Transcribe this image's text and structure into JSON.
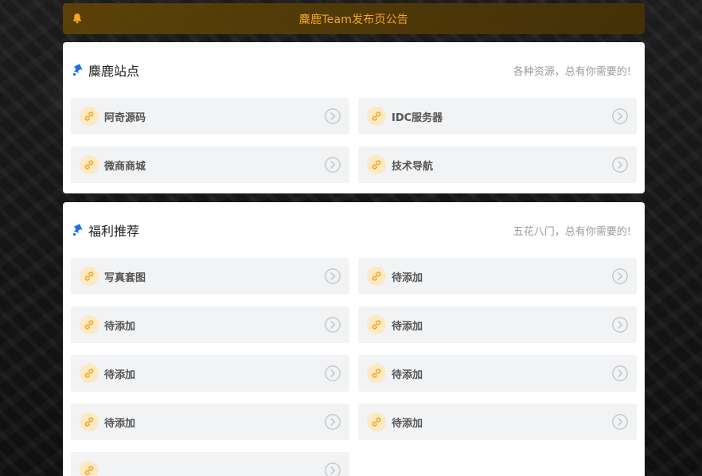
{
  "notice": {
    "text": "麋鹿Team发布页公告"
  },
  "sections": [
    {
      "title": "麋鹿站点",
      "subtitle": "各种资源，总有你需要的!",
      "items": [
        {
          "label": "阿奇源码"
        },
        {
          "label": "IDC服务器"
        },
        {
          "label": "微商商城"
        },
        {
          "label": "技术导航"
        }
      ]
    },
    {
      "title": "福利推荐",
      "subtitle": "五花八门，总有你需要的!",
      "items": [
        {
          "label": "写真套图"
        },
        {
          "label": "待添加"
        },
        {
          "label": "待添加"
        },
        {
          "label": "待添加"
        },
        {
          "label": "待添加"
        },
        {
          "label": "待添加"
        },
        {
          "label": "待添加"
        },
        {
          "label": "待添加"
        },
        {
          "label": ""
        }
      ]
    }
  ],
  "colors": {
    "accent": "#f5a623",
    "pin": "#1e6bff",
    "link_circle": "#fde9c4",
    "item_bg": "#f2f3f5"
  },
  "icons": {
    "notice": "bell-icon",
    "section": "pin-icon",
    "item": "link-icon",
    "item_action": "chevron-right-circle-icon"
  }
}
